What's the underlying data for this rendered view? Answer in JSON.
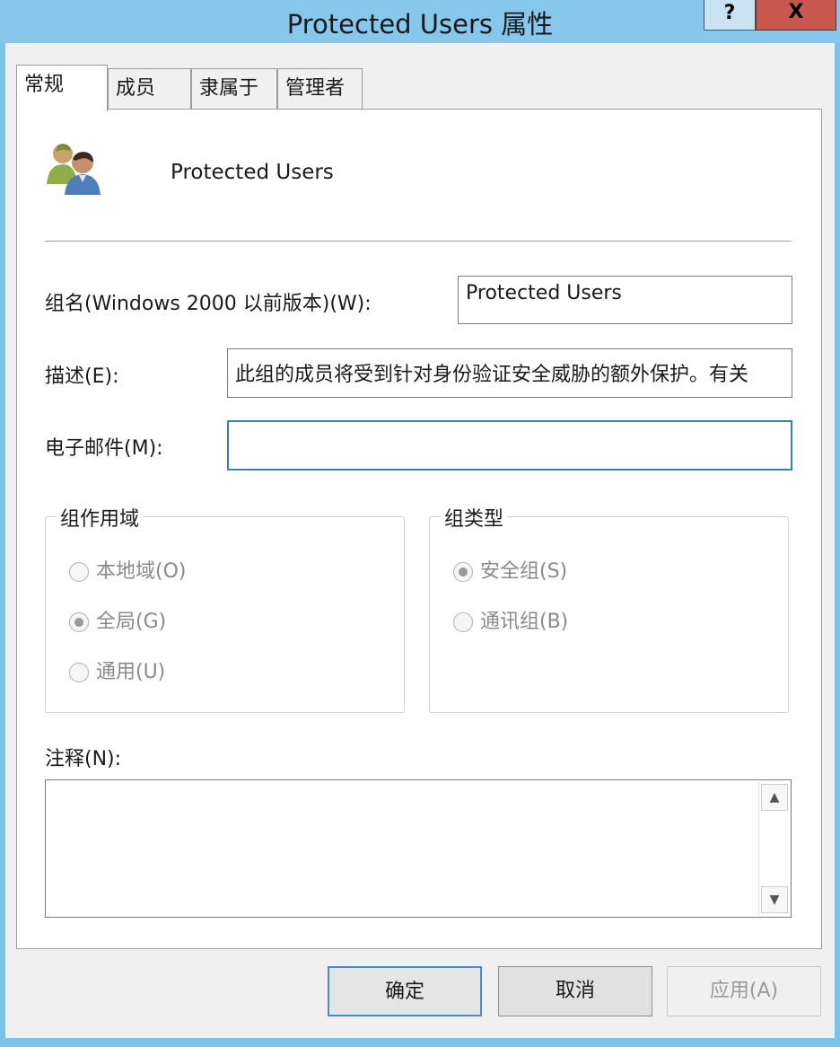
{
  "window": {
    "title": "Protected Users 属性",
    "help_label": "?",
    "close_label": "X"
  },
  "tabs": [
    {
      "label": "常规",
      "active": true
    },
    {
      "label": "成员",
      "active": false
    },
    {
      "label": "隶属于",
      "active": false
    },
    {
      "label": "管理者",
      "active": false
    }
  ],
  "general": {
    "group_icon": "group-users-icon",
    "group_name": "Protected Users",
    "pre2000_label": "组名(Windows 2000 以前版本)(W):",
    "pre2000_value": "Protected Users",
    "description_label": "描述(E):",
    "description_value": "此组的成员将受到针对身份验证安全威胁的额外保护。有关",
    "email_label": "电子邮件(M):",
    "email_value": "",
    "scope": {
      "title": "组作用域",
      "options": [
        {
          "label": "本地域(O)",
          "checked": false
        },
        {
          "label": "全局(G)",
          "checked": true
        },
        {
          "label": "通用(U)",
          "checked": false
        }
      ]
    },
    "type": {
      "title": "组类型",
      "options": [
        {
          "label": "安全组(S)",
          "checked": true
        },
        {
          "label": "通讯组(B)",
          "checked": false
        }
      ]
    },
    "notes_label": "注释(N):",
    "notes_value": ""
  },
  "buttons": {
    "ok": "确定",
    "cancel": "取消",
    "apply": "应用(A)"
  },
  "colors": {
    "titlebar": "#86c7eb",
    "close": "#c8574d",
    "default_button_border": "#4a8ccb"
  }
}
